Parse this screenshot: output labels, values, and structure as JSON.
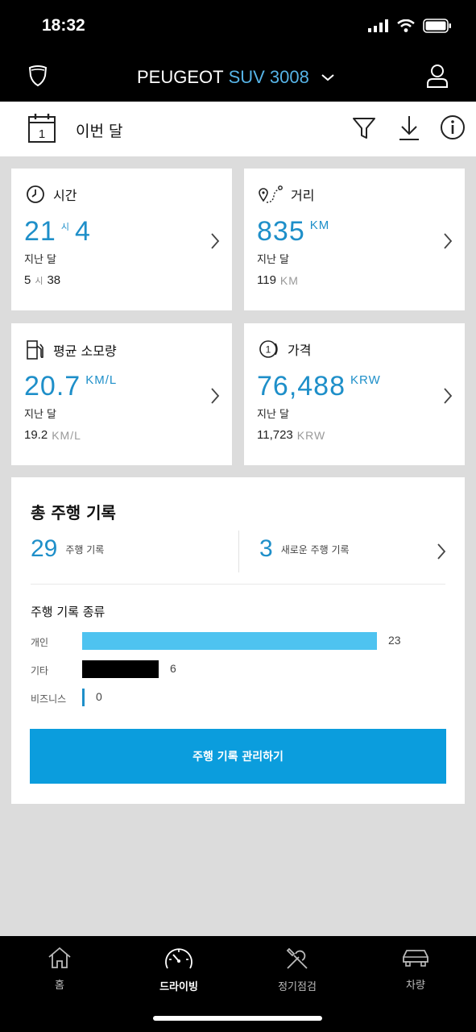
{
  "status_bar": {
    "time": "18:32"
  },
  "header": {
    "brand": "PEUGEOT",
    "model": "SUV 3008"
  },
  "period": {
    "label": "이번 달"
  },
  "cards": {
    "time": {
      "title": "시간",
      "hours": "21",
      "hours_unit": "시",
      "minutes": "4",
      "sub_label": "지난 달",
      "prev_hours": "5",
      "prev_hours_unit": "시",
      "prev_minutes": "38"
    },
    "distance": {
      "title": "거리",
      "value": "835",
      "unit": "KM",
      "sub_label": "지난 달",
      "prev_value": "119",
      "prev_unit": "KM"
    },
    "consumption": {
      "title": "평균 소모량",
      "value": "20.7",
      "unit": "KM/L",
      "sub_label": "지난 달",
      "prev_value": "19.2",
      "prev_unit": "KM/L"
    },
    "price": {
      "title": "가격",
      "value": "76,488",
      "unit": "KRW",
      "sub_label": "지난 달",
      "prev_value": "11,723",
      "prev_unit": "KRW"
    }
  },
  "summary": {
    "title": "총 주행 기록",
    "total_count": "29",
    "total_label": "주행 기록",
    "new_count": "3",
    "new_label": "새로운 주행 기록",
    "types_title": "주행 기록 종류",
    "types": [
      {
        "label": "개인",
        "value": "23",
        "count": 23,
        "color": "#4ec3f0"
      },
      {
        "label": "기타",
        "value": "6",
        "count": 6,
        "color": "#000000"
      },
      {
        "label": "비즈니스",
        "value": "0",
        "count": 0,
        "color": "#1e8fc9"
      }
    ],
    "manage_button": "주행 기록 관리하기"
  },
  "bottom_nav": {
    "items": [
      {
        "label": "홈",
        "icon": "home-icon"
      },
      {
        "label": "드라이빙",
        "icon": "speedometer-icon"
      },
      {
        "label": "정기점검",
        "icon": "tools-icon"
      },
      {
        "label": "차량",
        "icon": "car-icon"
      }
    ],
    "active": "드라이빙"
  },
  "colors": {
    "accent": "#1e8fc9",
    "button": "#0b9ddd",
    "bar_personal": "#4ec3f0"
  }
}
